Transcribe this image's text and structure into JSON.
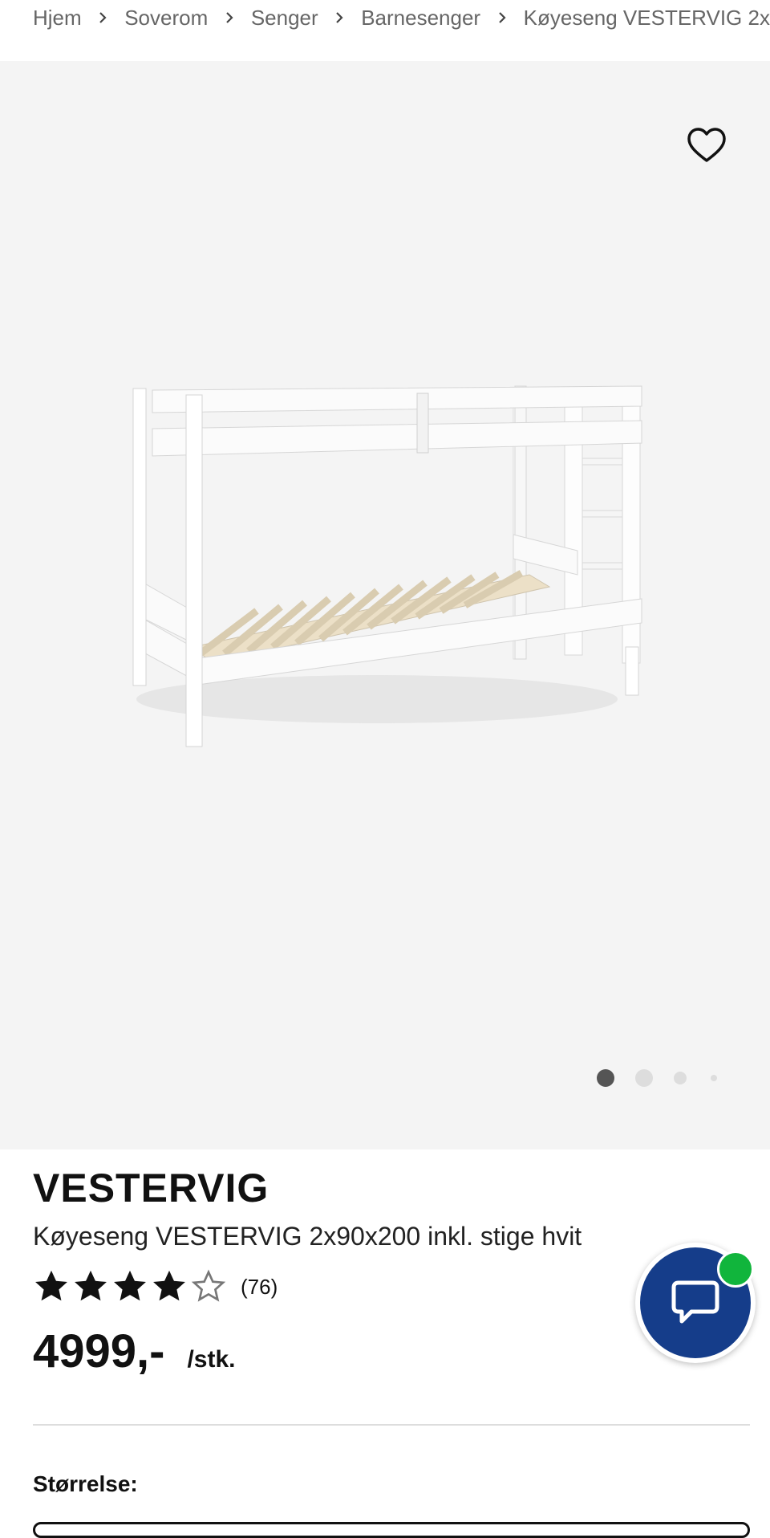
{
  "breadcrumb": [
    "Hjem",
    "Soverom",
    "Senger",
    "Barnesenger",
    "Køyeseng VESTERVIG 2x"
  ],
  "product": {
    "brand": "VESTERVIG",
    "description": "Køyeseng VESTERVIG 2x90x200 inkl. stige hvit",
    "rating": 4,
    "rating_max": 5,
    "review_count": "(76)",
    "price": "4999,-",
    "unit": "/stk."
  },
  "gallery": {
    "image_count": 4,
    "active_index": 0
  },
  "size_section": {
    "label": "Størrelse:"
  },
  "icons": {
    "favorite": "heart-outline-icon",
    "chat": "chat-bubble-icon",
    "separator": "chevron-right-icon",
    "star": "star-icon"
  },
  "colors": {
    "chat_bg": "#153d8a",
    "online": "#11b53c",
    "hero_bg": "#f4f4f4"
  }
}
